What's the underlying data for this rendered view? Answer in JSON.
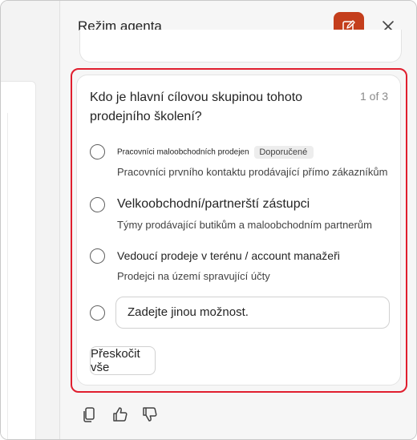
{
  "header": {
    "title": "Režim agenta",
    "compose_icon": "compose-icon",
    "close_icon": "close-icon"
  },
  "question": {
    "text": "Kdo je hlavní cílovou skupinou tohoto prodejního školení?",
    "counter": "1 of 3"
  },
  "options": [
    {
      "title": "Pracovníci maloobchodních prodejen",
      "badge": "Doporučené",
      "description": "Pracovníci prvního kontaktu prodávající přímo zákazníkům"
    },
    {
      "title": "Velkoobchodní/partnerští zástupci",
      "description": "Týmy prodávající butikům a maloobchodním partnerům"
    },
    {
      "title": "Vedoucí prodeje v terénu / account manažeři",
      "description": "Prodejci na území spravující účty"
    }
  ],
  "other": {
    "placeholder": "Zadejte jinou možnost."
  },
  "skip_label": "Přeskočit vše",
  "colors": {
    "accent": "#c43e1c",
    "highlight": "#e01e2e"
  },
  "footer_icons": [
    "copy-icon",
    "thumbs-up-icon",
    "thumbs-down-icon"
  ]
}
